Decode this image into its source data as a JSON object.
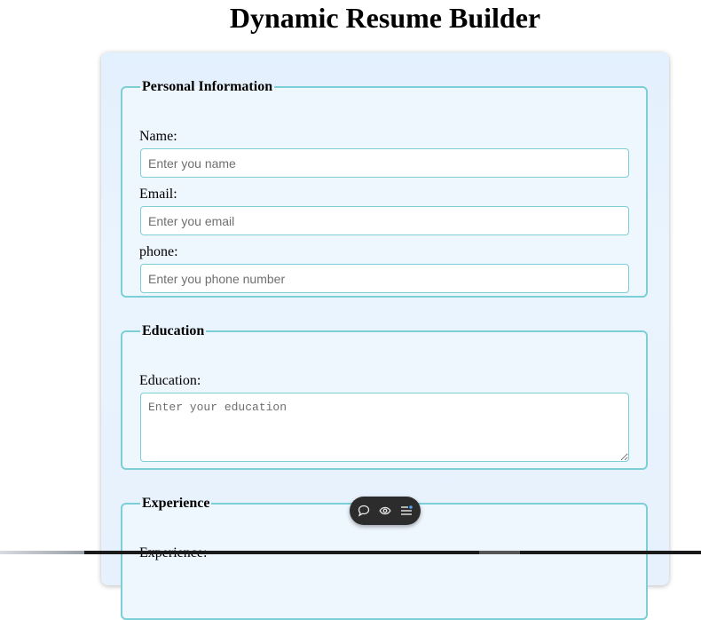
{
  "page": {
    "title": "Dynamic Resume Builder"
  },
  "personal": {
    "legend": "Personal Information",
    "name_label": "Name:",
    "name_placeholder": "Enter you name",
    "email_label": "Email:",
    "email_placeholder": "Enter you email",
    "phone_label": "phone:",
    "phone_placeholder": "Enter you phone number"
  },
  "education": {
    "legend": "Education",
    "label": "Education:",
    "placeholder": "Enter your education"
  },
  "experience": {
    "legend": "Experience",
    "label": "Experience:"
  },
  "toolbar": {
    "icons": [
      "comment-icon",
      "eye-icon",
      "menu-icon"
    ]
  },
  "colors": {
    "border_accent": "#7ccfd6",
    "card_background": "#e3f0fd",
    "toolbar_background": "#2c2c2c"
  }
}
